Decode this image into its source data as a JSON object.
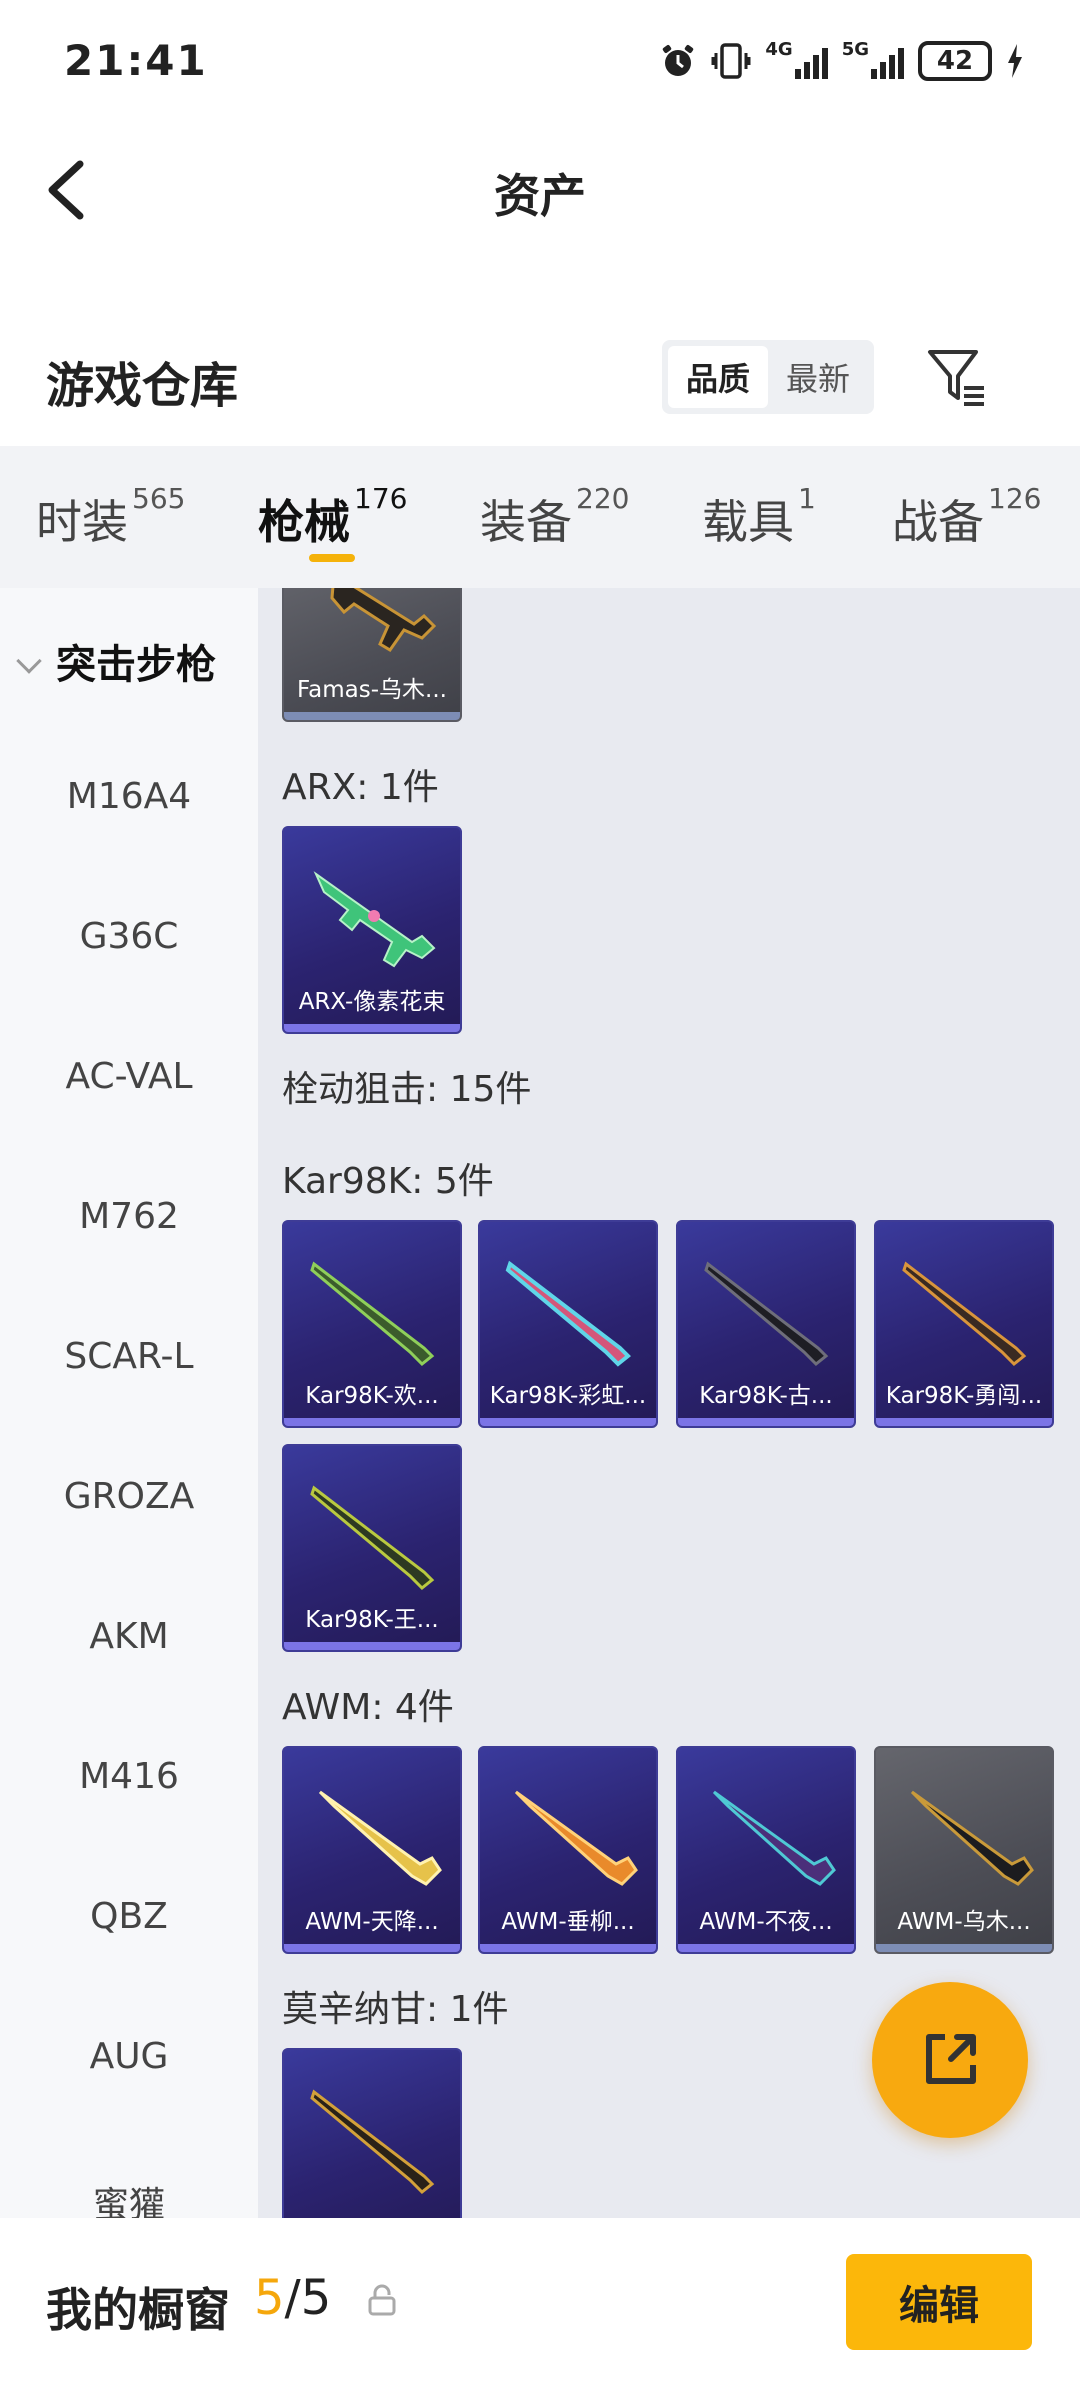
{
  "status_bar": {
    "time": "21:41",
    "net1": "4G",
    "net2": "5G",
    "battery": "42",
    "icons": [
      "alarm-icon",
      "vibrate-icon",
      "signal-4g-icon",
      "signal-5g-icon",
      "battery-icon",
      "charging-icon"
    ]
  },
  "header": {
    "title": "资产",
    "back_icon": "back-arrow-icon"
  },
  "warehouse": {
    "title": "游戏仓库",
    "sort_options": [
      "品质",
      "最新"
    ],
    "sort_selected": "品质",
    "filter_icon": "filter-icon"
  },
  "tabs": [
    {
      "label": "时装",
      "count": "565"
    },
    {
      "label": "枪械",
      "count": "176"
    },
    {
      "label": "装备",
      "count": "220"
    },
    {
      "label": "载具",
      "count": "1"
    },
    {
      "label": "战备",
      "count": "126"
    }
  ],
  "active_tab": "枪械",
  "sidebar": {
    "group": "突击步枪",
    "items": [
      "M16A4",
      "G36C",
      "AC-VAL",
      "M762",
      "SCAR-L",
      "GROZA",
      "AKM",
      "M416",
      "QBZ",
      "AUG",
      "蜜獾"
    ]
  },
  "content": {
    "partial_card": "Famas-乌木...",
    "arx": {
      "label": "ARX: 1件",
      "cards": [
        "ARX-像素花束"
      ]
    },
    "bolt_category": "栓动狙击: 15件",
    "kar98k": {
      "label": "Kar98K: 5件",
      "cards": [
        "Kar98K-欢...",
        "Kar98K-彩虹...",
        "Kar98K-古...",
        "Kar98K-勇闯...",
        "Kar98K-王..."
      ]
    },
    "awm": {
      "label": "AWM: 4件",
      "cards": [
        "AWM-天降...",
        "AWM-垂柳...",
        "AWM-不夜...",
        "AWM-乌木..."
      ]
    },
    "mosin": {
      "label": "莫辛纳甘: 1件"
    }
  },
  "fab_icon": "share-external-icon",
  "bottom_bar": {
    "title": "我的橱窗",
    "current": "5",
    "separator": "/",
    "total": "5",
    "lock_icon": "lock-icon",
    "edit_label": "编辑"
  },
  "colors": {
    "accent": "#fcb70a",
    "purple_card": "#2b2370",
    "gray_card": "#4c4d55"
  }
}
